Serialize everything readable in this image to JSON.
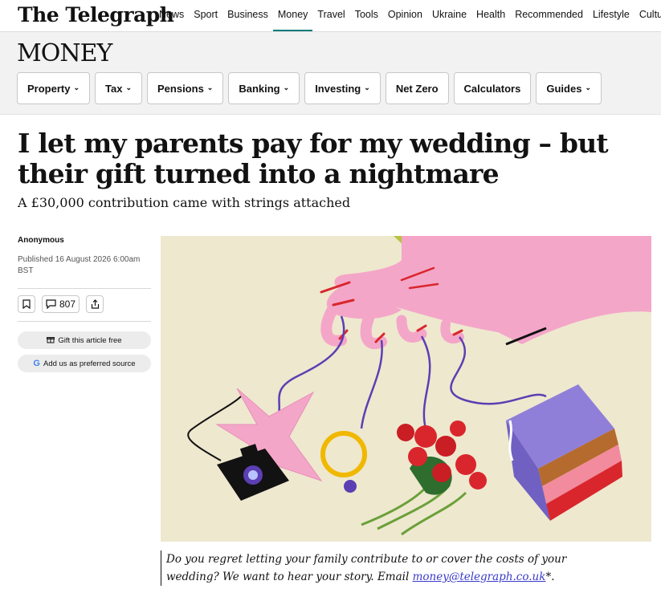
{
  "header": {
    "logo": "The Telegraph",
    "nav": [
      "News",
      "Sport",
      "Business",
      "Money",
      "Travel",
      "Tools",
      "Opinion",
      "Ukraine",
      "Health",
      "Recommended",
      "Lifestyle",
      "Culture"
    ],
    "active_nav": "Money"
  },
  "section": {
    "title": "MONEY",
    "subnav": [
      {
        "label": "Property",
        "dropdown": true
      },
      {
        "label": "Tax",
        "dropdown": true
      },
      {
        "label": "Pensions",
        "dropdown": true
      },
      {
        "label": "Banking",
        "dropdown": true
      },
      {
        "label": "Investing",
        "dropdown": true
      },
      {
        "label": "Net Zero",
        "dropdown": false
      },
      {
        "label": "Calculators",
        "dropdown": false
      },
      {
        "label": "Guides",
        "dropdown": true
      }
    ]
  },
  "article": {
    "headline": "I let my parents pay for my wedding – but their gift turned into a nightmare",
    "standfirst": "A £30,000 contribution came with strings attached",
    "author": "Anonymous",
    "published": "Published 16 August 2026 6:00am BST",
    "comment_count": "807",
    "gift_label": "Gift this article free",
    "preferred_source_label": "Add us as preferred source",
    "image_alt": "Illustration of a hand holding strings tied to a ring, flowers, a camera and a cake",
    "callout_text": "Do you regret letting your family contribute to or cover the costs of your wedding? We want to hear your story. Email ",
    "callout_email": "money@telegraph.co.uk",
    "callout_suffix": "*."
  },
  "colors": {
    "accent": "#007a7a",
    "illustration_bg": "#eee8cf",
    "hand_pink": "#f4a6c8",
    "string_purple": "#5b3fb3"
  }
}
